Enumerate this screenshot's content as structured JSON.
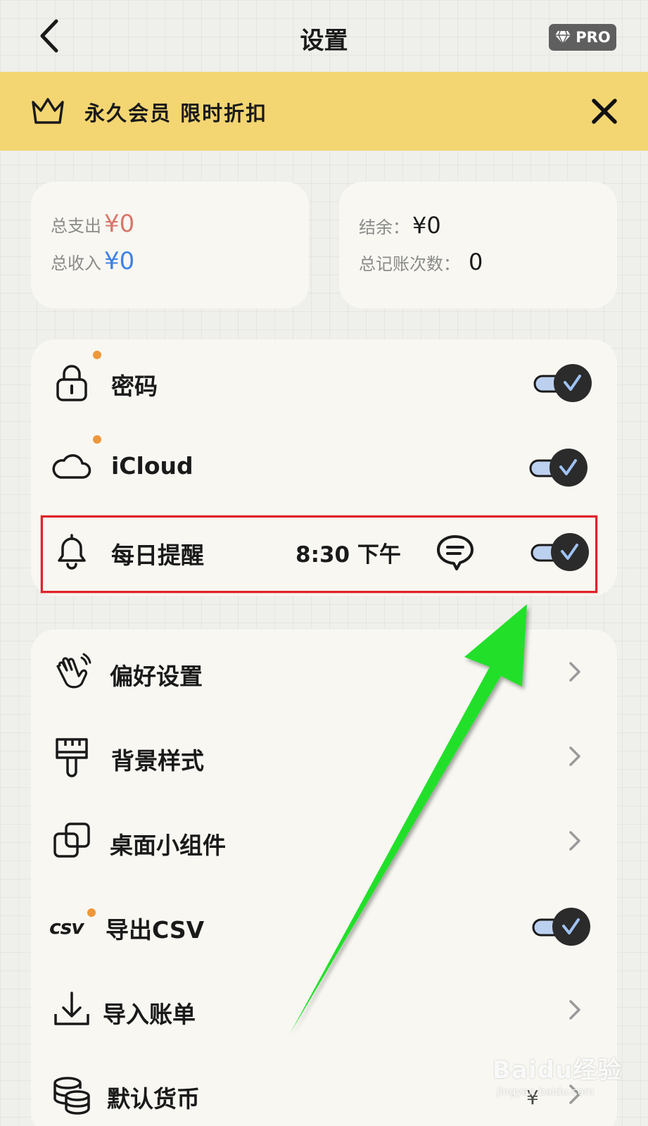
{
  "nav": {
    "title": "设置",
    "pro_label": "PRO"
  },
  "banner": {
    "text": "永久会员 限时折扣"
  },
  "stats": {
    "expense_label": "总支出",
    "expense_value": "¥0",
    "income_label": "总收入",
    "income_value": "¥0",
    "balance_label": "结余：",
    "balance_value": "¥0",
    "count_label": "总记账次数：",
    "count_value": "0"
  },
  "toggles": {
    "password": {
      "label": "密码",
      "on": true
    },
    "icloud": {
      "label": "iCloud",
      "on": true
    },
    "reminder": {
      "label": "每日提醒",
      "time": "8:30 下午",
      "on": true
    }
  },
  "menu": {
    "preferences": "偏好设置",
    "background": "背景样式",
    "widgets": "桌面小组件",
    "export_csv": {
      "icon_text": "csv",
      "label": "导出CSV",
      "on": true
    },
    "import": "导入账单",
    "currency": {
      "label": "默认货币",
      "value": "¥"
    }
  },
  "watermark": {
    "brand": "Baidu经验",
    "url": "jingyan.baidu.com"
  },
  "colors": {
    "banner": "#f3d572",
    "expense": "#d9766a",
    "income": "#3f80e6",
    "accent_dot": "#ee973b",
    "highlight": "#e0232a",
    "arrow": "#22e02a"
  }
}
